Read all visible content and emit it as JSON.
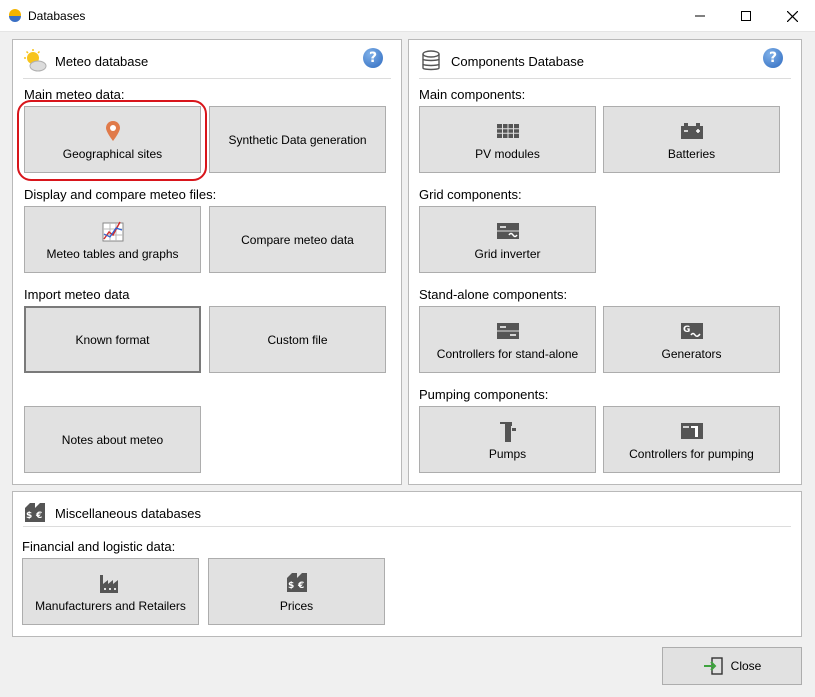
{
  "window": {
    "title": "Databases",
    "min_icon": "minimize-icon",
    "max_icon": "maximize-icon",
    "close_icon": "close-icon"
  },
  "meteo": {
    "title": "Meteo database",
    "main_label": "Main meteo data:",
    "geo_btn": "Geographical sites",
    "synth_btn": "Synthetic Data generation",
    "display_label": "Display and compare meteo files:",
    "tables_btn": "Meteo tables and graphs",
    "compare_btn": "Compare meteo data",
    "import_label": "Import meteo data",
    "known_btn": "Known format",
    "custom_btn": "Custom file",
    "notes_btn": "Notes about meteo"
  },
  "components": {
    "title": "Components Database",
    "main_label": "Main components:",
    "pv_btn": "PV modules",
    "batteries_btn": "Batteries",
    "grid_label": "Grid components:",
    "inverter_btn": "Grid inverter",
    "standalone_label": "Stand-alone components:",
    "controllers_btn": "Controllers for stand-alone",
    "generators_btn": "Generators",
    "pumping_label": "Pumping components:",
    "pumps_btn": "Pumps",
    "pump_ctrl_btn": "Controllers for pumping"
  },
  "misc": {
    "title": "Miscellaneous databases",
    "fin_label": "Financial and logistic data:",
    "manuf_btn": "Manufacturers and Retailers",
    "prices_btn": "Prices"
  },
  "footer": {
    "close_btn": "Close"
  },
  "colors": {
    "highlight": "#d8151b",
    "help": "#2f6bc0",
    "button_bg": "#e1e1e1"
  }
}
